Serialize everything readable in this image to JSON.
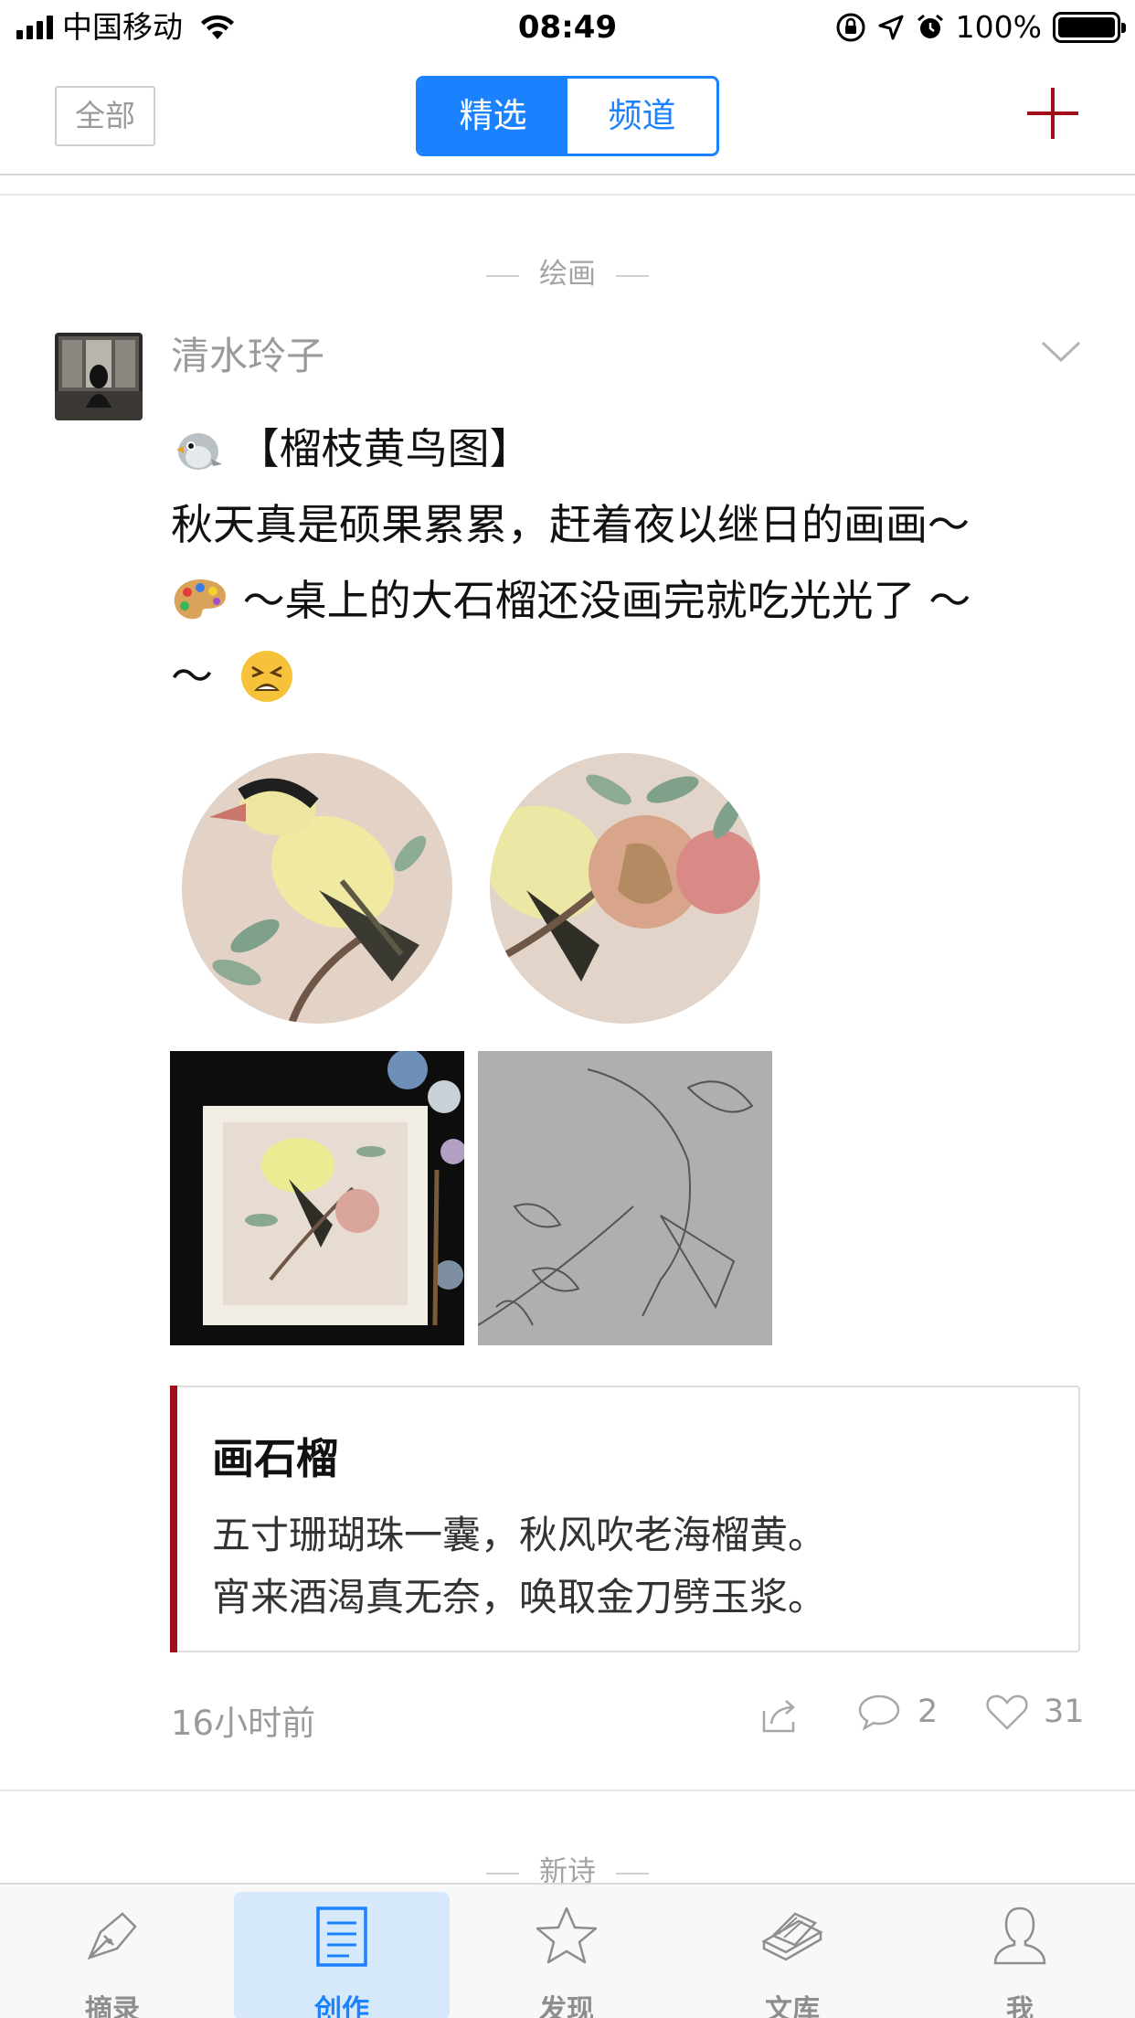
{
  "status_bar": {
    "carrier": "中国移动",
    "time": "08:49",
    "battery": "100%",
    "battery_level": 1.0
  },
  "nav": {
    "all_label": "全部",
    "segments": [
      {
        "label": "精选",
        "active": true
      },
      {
        "label": "频道",
        "active": false
      }
    ],
    "add_icon": "plus-icon",
    "accent_color": "#1a82ff",
    "add_color": "#a0101b"
  },
  "feed": {
    "section_title": "绘画",
    "post": {
      "author": "清水玲子",
      "title_line": "【榴枝黄鸟图】",
      "body_line1": "秋天真是硕果累累，赶着夜以继日的画画～",
      "body_line2": "～桌上的大石榴还没画完就吃光光了 ～",
      "body_line3": "～",
      "emojis": [
        "bird-emoji",
        "palette-emoji",
        "tired-face-emoji"
      ],
      "images": [
        "oriole-round-painting",
        "pomegranate-round-painting",
        "painting-on-desk-photo",
        "pencil-sketch-photo"
      ],
      "quote": {
        "title": "画石榴",
        "line1": "五寸珊瑚珠一囊，秋风吹老海榴黄。",
        "line2": "宵来酒渴真无奈，唤取金刀劈玉浆。",
        "bar_color": "#a0101b"
      },
      "time": "16小时前",
      "comments": "2",
      "likes": "31"
    },
    "next_section_title": "新诗"
  },
  "tab_bar": {
    "tabs": [
      {
        "label": "摘录",
        "icon": "pen-nib-icon",
        "active": false
      },
      {
        "label": "创作",
        "icon": "document-icon",
        "active": true
      },
      {
        "label": "发现",
        "icon": "star-icon",
        "active": false
      },
      {
        "label": "文库",
        "icon": "books-icon",
        "active": false
      },
      {
        "label": "我",
        "icon": "person-icon",
        "active": false
      }
    ]
  }
}
